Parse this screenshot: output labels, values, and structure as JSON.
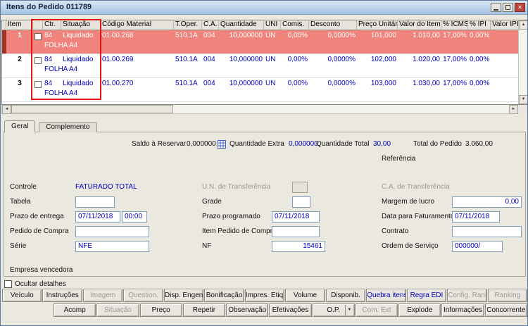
{
  "colors": {
    "selected_row_bg": "#f0837c",
    "selected_row_marker": "#a13227",
    "value_text": "#0000bf",
    "annotation": "#e41414"
  },
  "window": {
    "title": "Itens do Pedido 011789"
  },
  "grid": {
    "headers": [
      "Item",
      "Ctr.",
      "Situação",
      "Código Material",
      "T.Oper.",
      "C.A.",
      "Quantidade",
      "UNI",
      "Comis.",
      "Desconto",
      "Preço Unitário",
      "Valor do Item",
      "% ICMS",
      "% IPI",
      "Valor IPI"
    ],
    "rows": [
      {
        "item": "1",
        "ctr": "84",
        "situacao": "Liquidado",
        "descricao": "FOLHA A4",
        "codigo": "01.00.268",
        "toper": "510.1A",
        "ca": "004",
        "quantidade": "10,000000",
        "uni": "UN",
        "comis": "0,00%",
        "desconto": "0,0000%",
        "preco_unitario": "101,000",
        "valor_item": "1.010,00",
        "icms": "17,00%",
        "ipi": "0,00%",
        "valor_ipi": "",
        "selected": true
      },
      {
        "item": "2",
        "ctr": "84",
        "situacao": "Liquidado",
        "descricao": "FOLHA A4",
        "codigo": "01.00.269",
        "toper": "510.1A",
        "ca": "004",
        "quantidade": "10,000000",
        "uni": "UN",
        "comis": "0,00%",
        "desconto": "0,0000%",
        "preco_unitario": "102,000",
        "valor_item": "1.020,00",
        "icms": "17,00%",
        "ipi": "0,00%",
        "valor_ipi": "",
        "selected": false
      },
      {
        "item": "3",
        "ctr": "84",
        "situacao": "Liquidado",
        "descricao": "FOLHA A4",
        "codigo": "01.00.270",
        "toper": "510.1A",
        "ca": "004",
        "quantidade": "10,000000",
        "uni": "UN",
        "comis": "0,00%",
        "desconto": "0,0000%",
        "preco_unitario": "103,000",
        "valor_item": "1.030,00",
        "icms": "17,00%",
        "ipi": "0,00%",
        "valor_ipi": "",
        "selected": false
      }
    ]
  },
  "tabs": {
    "geral": "Geral",
    "complemento": "Complemento"
  },
  "summary": {
    "saldo_label": "Saldo à Reservar",
    "saldo_value": "0,000000",
    "qtd_extra_label": "Quantidade Extra",
    "qtd_extra_value": "0,000000",
    "qtd_total_label": "Quantidade Total",
    "qtd_total_value": "30,00",
    "total_label": "Total do Pedido",
    "total_value": "3.060,00",
    "referencia_label": "Referência"
  },
  "form": {
    "controle_label": "Controle",
    "controle_value": "FATURADO TOTAL",
    "un_transf_label": "U.N. de Transferência",
    "un_transf_value": "",
    "ca_transf_label": "C.A. de Transferência",
    "tabela_label": "Tabela",
    "tabela_value": "",
    "grade_label": "Grade",
    "grade_value": "",
    "margem_label": "Margem de lucro",
    "margem_value": "0,00",
    "prazo_entrega_label": "Prazo de entrega",
    "prazo_entrega_data": "07/11/2018",
    "prazo_entrega_hora": "00:00",
    "prazo_prog_label": "Prazo programado",
    "prazo_prog_value": "07/11/2018",
    "data_fat_label": "Data para Faturamento",
    "data_fat_value": "07/11/2018",
    "pedido_compra_label": "Pedido de Compra",
    "pedido_compra_value": "",
    "item_pedido_label": "Item Pedido de Compra",
    "item_pedido_value": "",
    "contrato_label": "Contrato",
    "contrato_value": "",
    "serie_label": "Série",
    "serie_value": "NFE",
    "nf_label": "NF",
    "nf_value": "15461",
    "ordem_label": "Ordem de Serviço",
    "ordem_value": "000000/",
    "empresa_label": "Empresa vencedora"
  },
  "footer": {
    "ocultar_label": "Ocultar detalhes",
    "row1": [
      {
        "label": "Veículo",
        "state": "normal"
      },
      {
        "label": "Instruções",
        "state": "normal"
      },
      {
        "label": "Imagem",
        "state": "disabled"
      },
      {
        "label": "Question.",
        "state": "disabled"
      },
      {
        "label": "Disp. Engenh.",
        "state": "normal"
      },
      {
        "label": "Bonificação",
        "state": "normal"
      },
      {
        "label": "Impres. Etiq.",
        "state": "normal"
      },
      {
        "label": "Volume",
        "state": "normal"
      },
      {
        "label": "Disponib.",
        "state": "normal"
      },
      {
        "label": "Quebra itens",
        "state": "accent"
      },
      {
        "label": "Regra EDI",
        "state": "accent"
      },
      {
        "label": "Config. Rank.",
        "state": "disabled"
      },
      {
        "label": "Ranking",
        "state": "disabled"
      }
    ],
    "row2": [
      {
        "label": "Acomp",
        "state": "normal"
      },
      {
        "label": "Situação",
        "state": "disabled"
      },
      {
        "label": "Preço",
        "state": "normal"
      },
      {
        "label": "Repetir",
        "state": "normal"
      },
      {
        "label": "Observação",
        "state": "normal"
      },
      {
        "label": "Efetivações",
        "state": "normal"
      },
      {
        "label": "O.P.",
        "state": "normal",
        "dropdown": true
      },
      {
        "label": "Com. Ext",
        "state": "disabled"
      },
      {
        "label": "Explode",
        "state": "normal"
      },
      {
        "label": "Informações",
        "state": "normal"
      },
      {
        "label": "Concorrente",
        "state": "normal"
      }
    ]
  }
}
